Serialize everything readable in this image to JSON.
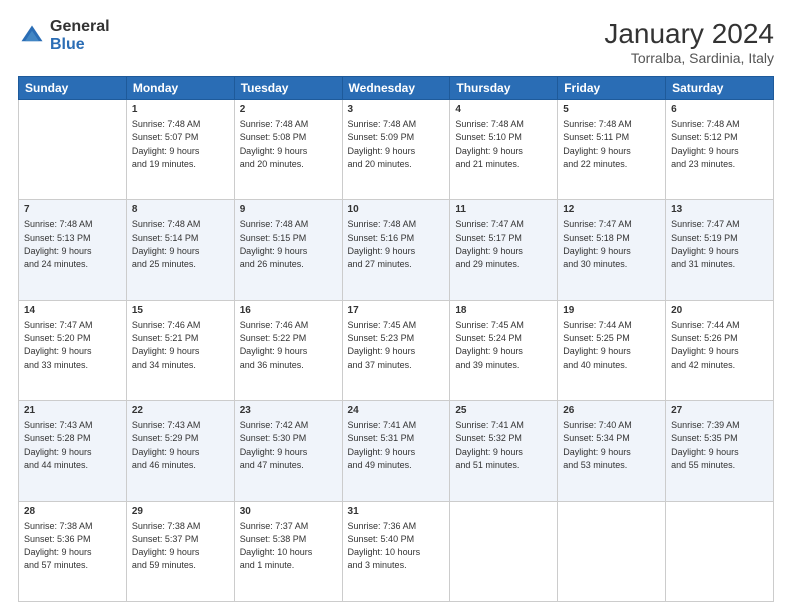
{
  "header": {
    "logo_general": "General",
    "logo_blue": "Blue",
    "month_year": "January 2024",
    "location": "Torralba, Sardinia, Italy"
  },
  "days_of_week": [
    "Sunday",
    "Monday",
    "Tuesday",
    "Wednesday",
    "Thursday",
    "Friday",
    "Saturday"
  ],
  "weeks": [
    [
      {
        "day": "",
        "content": ""
      },
      {
        "day": "1",
        "content": "Sunrise: 7:48 AM\nSunset: 5:07 PM\nDaylight: 9 hours\nand 19 minutes."
      },
      {
        "day": "2",
        "content": "Sunrise: 7:48 AM\nSunset: 5:08 PM\nDaylight: 9 hours\nand 20 minutes."
      },
      {
        "day": "3",
        "content": "Sunrise: 7:48 AM\nSunset: 5:09 PM\nDaylight: 9 hours\nand 20 minutes."
      },
      {
        "day": "4",
        "content": "Sunrise: 7:48 AM\nSunset: 5:10 PM\nDaylight: 9 hours\nand 21 minutes."
      },
      {
        "day": "5",
        "content": "Sunrise: 7:48 AM\nSunset: 5:11 PM\nDaylight: 9 hours\nand 22 minutes."
      },
      {
        "day": "6",
        "content": "Sunrise: 7:48 AM\nSunset: 5:12 PM\nDaylight: 9 hours\nand 23 minutes."
      }
    ],
    [
      {
        "day": "7",
        "content": "Sunrise: 7:48 AM\nSunset: 5:13 PM\nDaylight: 9 hours\nand 24 minutes."
      },
      {
        "day": "8",
        "content": "Sunrise: 7:48 AM\nSunset: 5:14 PM\nDaylight: 9 hours\nand 25 minutes."
      },
      {
        "day": "9",
        "content": "Sunrise: 7:48 AM\nSunset: 5:15 PM\nDaylight: 9 hours\nand 26 minutes."
      },
      {
        "day": "10",
        "content": "Sunrise: 7:48 AM\nSunset: 5:16 PM\nDaylight: 9 hours\nand 27 minutes."
      },
      {
        "day": "11",
        "content": "Sunrise: 7:47 AM\nSunset: 5:17 PM\nDaylight: 9 hours\nand 29 minutes."
      },
      {
        "day": "12",
        "content": "Sunrise: 7:47 AM\nSunset: 5:18 PM\nDaylight: 9 hours\nand 30 minutes."
      },
      {
        "day": "13",
        "content": "Sunrise: 7:47 AM\nSunset: 5:19 PM\nDaylight: 9 hours\nand 31 minutes."
      }
    ],
    [
      {
        "day": "14",
        "content": "Sunrise: 7:47 AM\nSunset: 5:20 PM\nDaylight: 9 hours\nand 33 minutes."
      },
      {
        "day": "15",
        "content": "Sunrise: 7:46 AM\nSunset: 5:21 PM\nDaylight: 9 hours\nand 34 minutes."
      },
      {
        "day": "16",
        "content": "Sunrise: 7:46 AM\nSunset: 5:22 PM\nDaylight: 9 hours\nand 36 minutes."
      },
      {
        "day": "17",
        "content": "Sunrise: 7:45 AM\nSunset: 5:23 PM\nDaylight: 9 hours\nand 37 minutes."
      },
      {
        "day": "18",
        "content": "Sunrise: 7:45 AM\nSunset: 5:24 PM\nDaylight: 9 hours\nand 39 minutes."
      },
      {
        "day": "19",
        "content": "Sunrise: 7:44 AM\nSunset: 5:25 PM\nDaylight: 9 hours\nand 40 minutes."
      },
      {
        "day": "20",
        "content": "Sunrise: 7:44 AM\nSunset: 5:26 PM\nDaylight: 9 hours\nand 42 minutes."
      }
    ],
    [
      {
        "day": "21",
        "content": "Sunrise: 7:43 AM\nSunset: 5:28 PM\nDaylight: 9 hours\nand 44 minutes."
      },
      {
        "day": "22",
        "content": "Sunrise: 7:43 AM\nSunset: 5:29 PM\nDaylight: 9 hours\nand 46 minutes."
      },
      {
        "day": "23",
        "content": "Sunrise: 7:42 AM\nSunset: 5:30 PM\nDaylight: 9 hours\nand 47 minutes."
      },
      {
        "day": "24",
        "content": "Sunrise: 7:41 AM\nSunset: 5:31 PM\nDaylight: 9 hours\nand 49 minutes."
      },
      {
        "day": "25",
        "content": "Sunrise: 7:41 AM\nSunset: 5:32 PM\nDaylight: 9 hours\nand 51 minutes."
      },
      {
        "day": "26",
        "content": "Sunrise: 7:40 AM\nSunset: 5:34 PM\nDaylight: 9 hours\nand 53 minutes."
      },
      {
        "day": "27",
        "content": "Sunrise: 7:39 AM\nSunset: 5:35 PM\nDaylight: 9 hours\nand 55 minutes."
      }
    ],
    [
      {
        "day": "28",
        "content": "Sunrise: 7:38 AM\nSunset: 5:36 PM\nDaylight: 9 hours\nand 57 minutes."
      },
      {
        "day": "29",
        "content": "Sunrise: 7:38 AM\nSunset: 5:37 PM\nDaylight: 9 hours\nand 59 minutes."
      },
      {
        "day": "30",
        "content": "Sunrise: 7:37 AM\nSunset: 5:38 PM\nDaylight: 10 hours\nand 1 minute."
      },
      {
        "day": "31",
        "content": "Sunrise: 7:36 AM\nSunset: 5:40 PM\nDaylight: 10 hours\nand 3 minutes."
      },
      {
        "day": "",
        "content": ""
      },
      {
        "day": "",
        "content": ""
      },
      {
        "day": "",
        "content": ""
      }
    ]
  ]
}
